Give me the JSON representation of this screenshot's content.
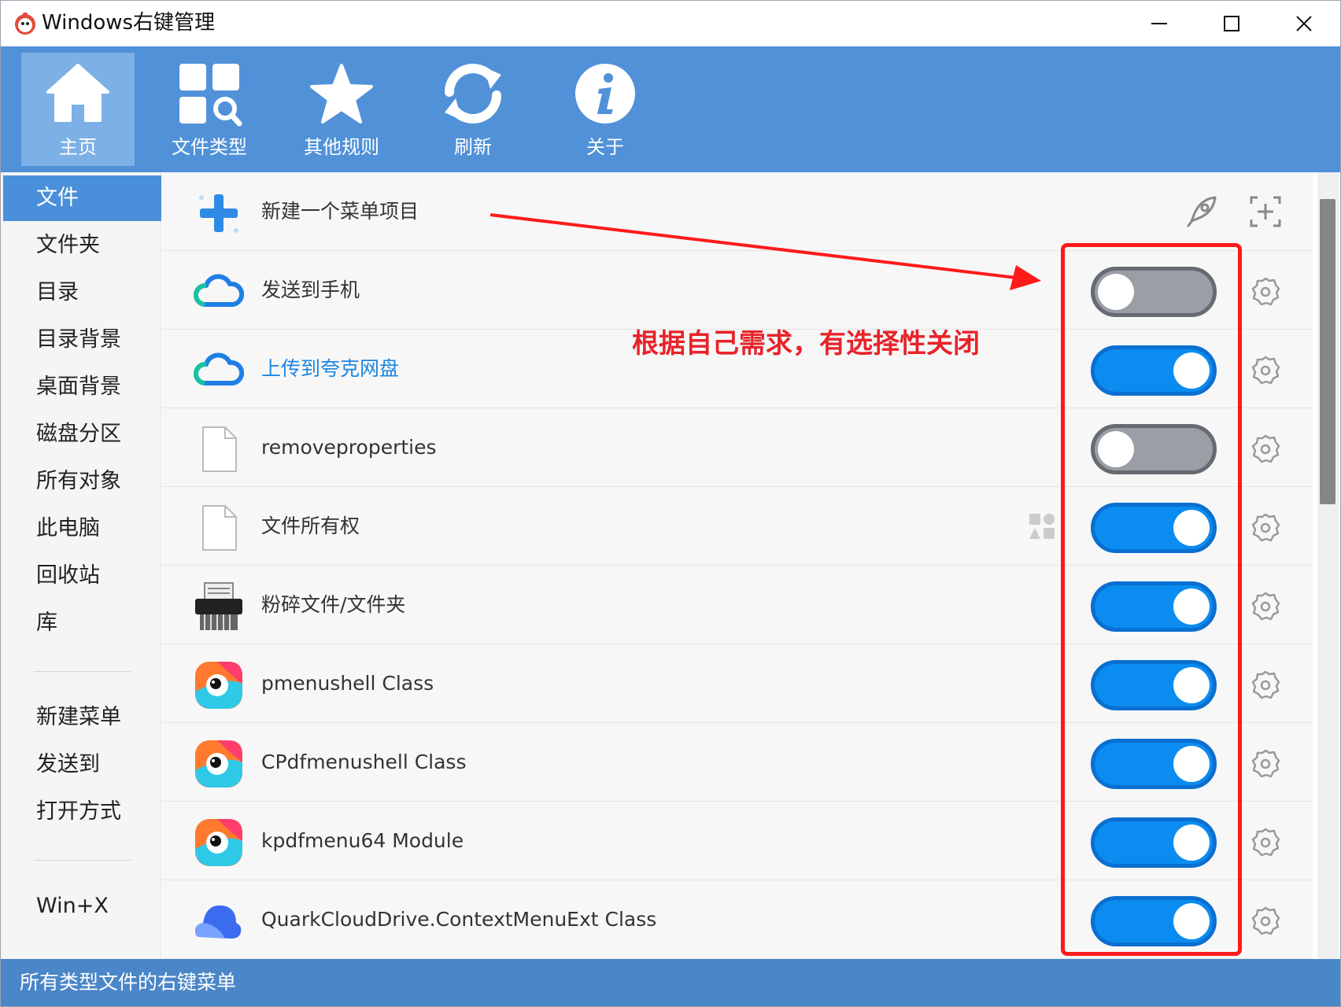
{
  "window": {
    "title": "Windows右键管理"
  },
  "toolbar": {
    "items": [
      {
        "label": "主页",
        "icon": "home-icon"
      },
      {
        "label": "文件类型",
        "icon": "file-type-search-icon"
      },
      {
        "label": "其他规则",
        "icon": "star-icon"
      },
      {
        "label": "刷新",
        "icon": "refresh-icon"
      },
      {
        "label": "关于",
        "icon": "info-icon"
      }
    ]
  },
  "sidebar": {
    "items": [
      "文件",
      "文件夹",
      "目录",
      "目录背景",
      "桌面背景",
      "磁盘分区",
      "所有对象",
      "此电脑",
      "回收站",
      "库"
    ],
    "items2": [
      "新建菜单",
      "发送到",
      "打开方式"
    ],
    "items3": [
      "Win+X"
    ]
  },
  "main": {
    "new_item_label": "新建一个菜单项目",
    "rows": [
      {
        "label": "发送到手机",
        "icon": "cloud-icon",
        "enabled": false
      },
      {
        "label": "上传到夸克网盘",
        "icon": "cloud-icon",
        "enabled": true
      },
      {
        "label": "removeproperties",
        "icon": "file-icon",
        "enabled": false
      },
      {
        "label": "文件所有权",
        "icon": "file-icon",
        "enabled": true
      },
      {
        "label": "粉碎文件/文件夹",
        "icon": "shredder-icon",
        "enabled": true
      },
      {
        "label": "pmenushell Class",
        "icon": "wps-pdf-icon",
        "enabled": true
      },
      {
        "label": "CPdfmenushell Class",
        "icon": "wps-pdf-icon",
        "enabled": true
      },
      {
        "label": "kpdfmenu64 Module",
        "icon": "wps-pdf-icon",
        "enabled": true
      },
      {
        "label": "QuarkCloudDrive.ContextMenuExt Class",
        "icon": "quark-cloud-icon",
        "enabled": true
      }
    ]
  },
  "annotation": {
    "text": "根据自己需求，有选择性关闭",
    "color": "#e8232a"
  },
  "status": {
    "text": "所有类型文件的右键菜单"
  },
  "colors": {
    "accent": "#5191d8",
    "toggle_on": "#0a8cf0",
    "toggle_off": "#9a9fa6"
  }
}
